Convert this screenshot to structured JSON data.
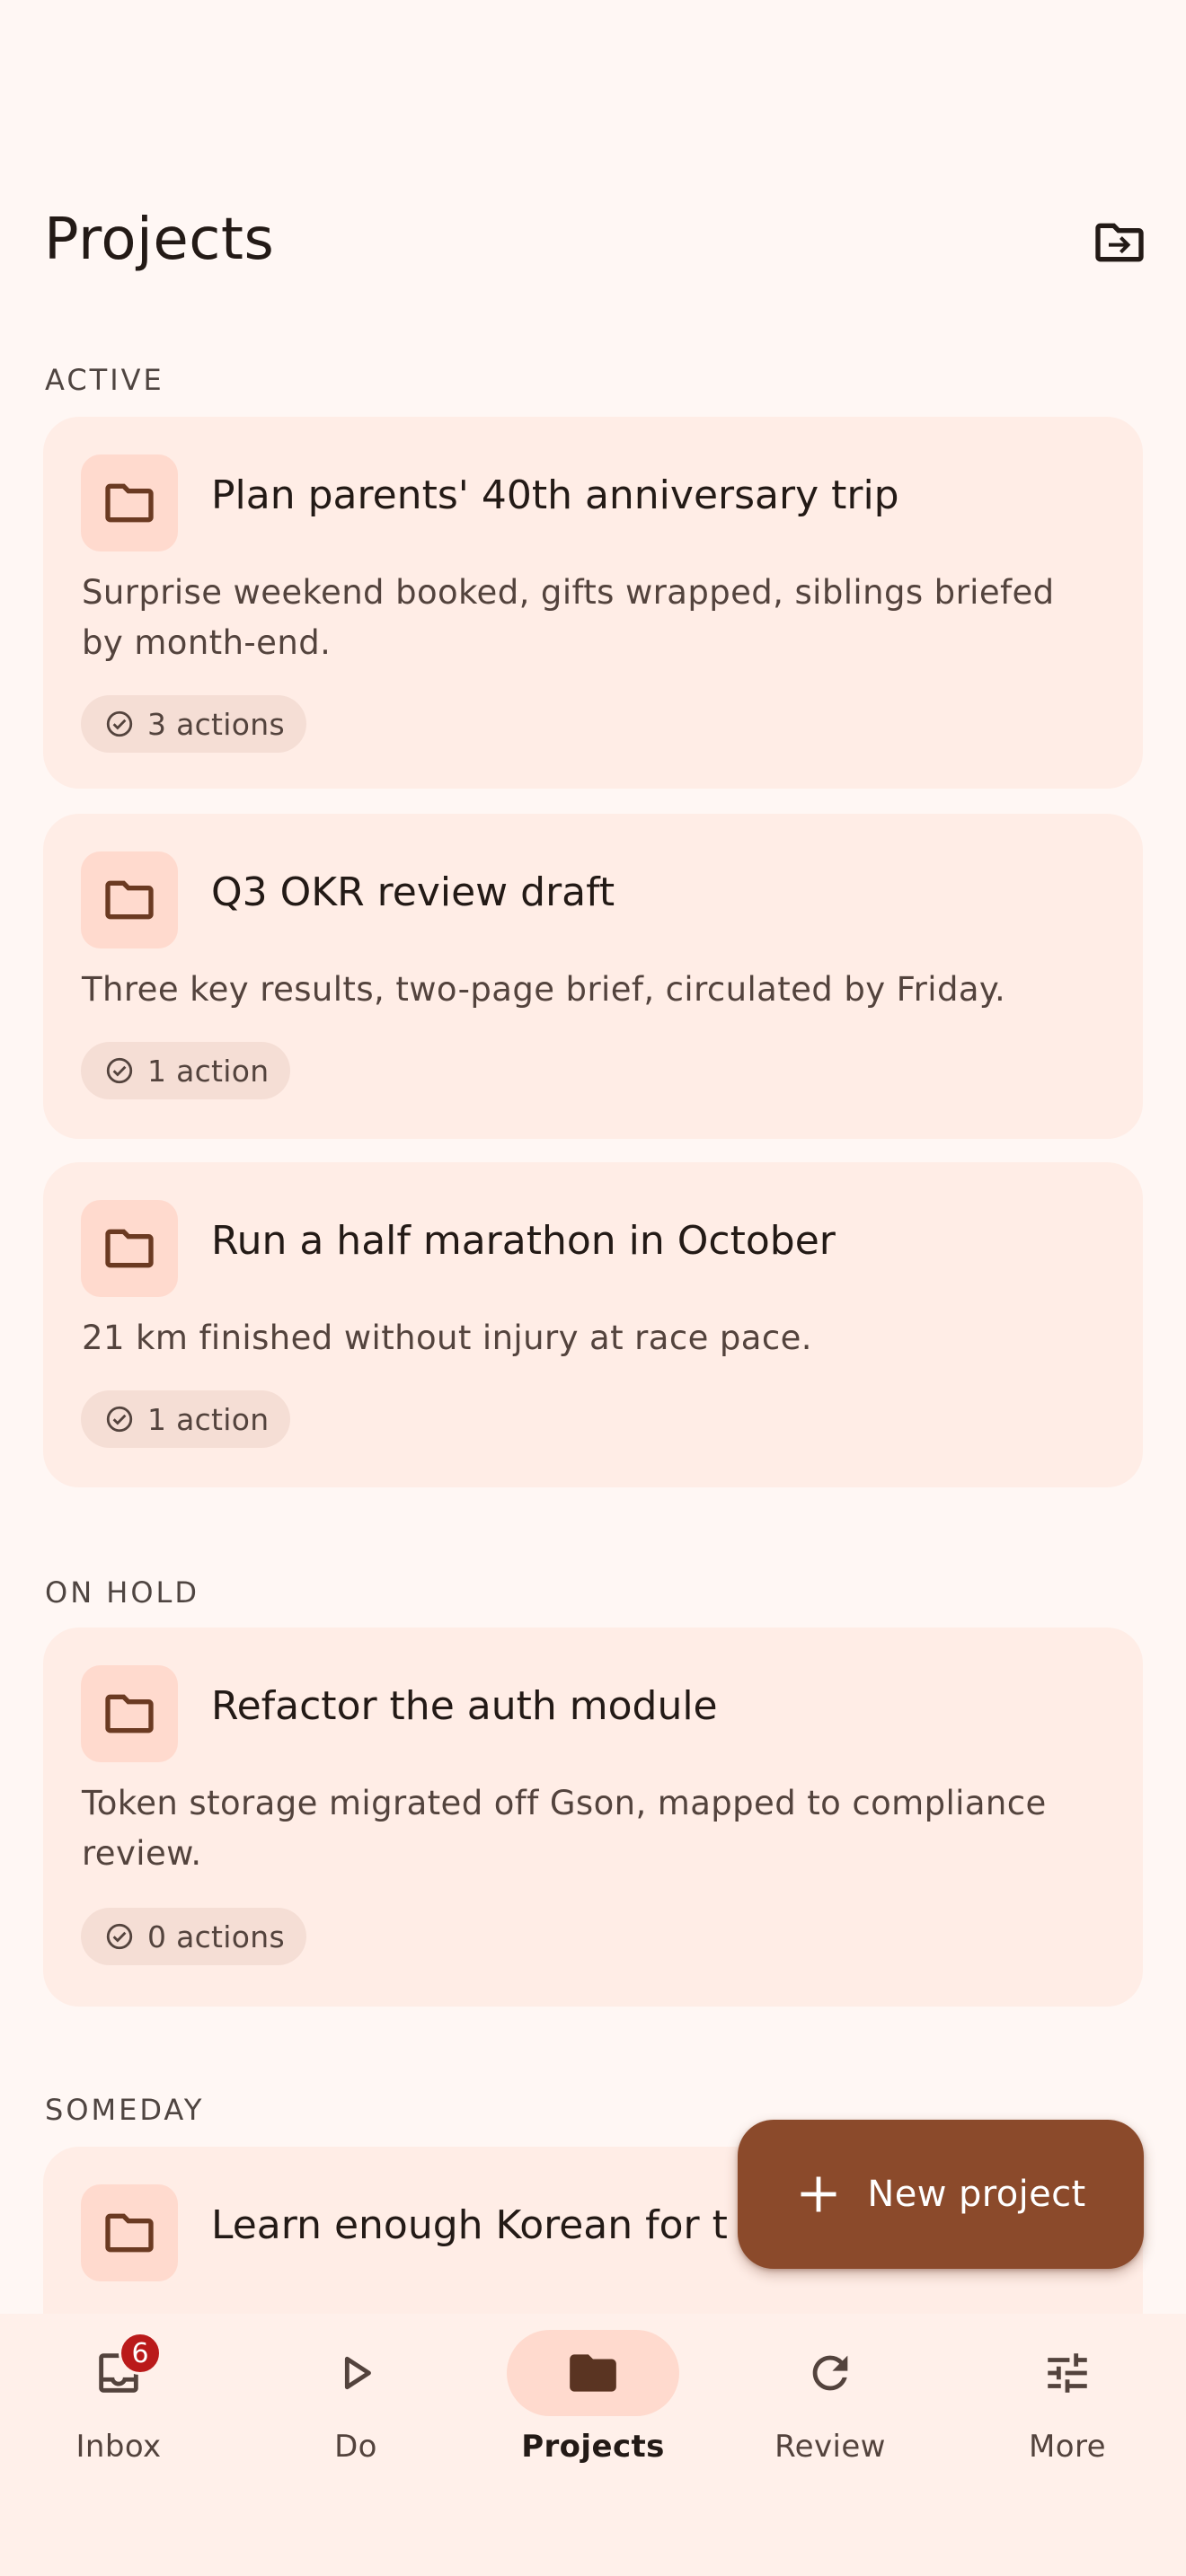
{
  "header": {
    "title": "Projects",
    "action_icon": "folder-move-icon"
  },
  "sections": [
    {
      "label": "ACTIVE"
    },
    {
      "label": "ON HOLD"
    },
    {
      "label": "SOMEDAY"
    }
  ],
  "projects": [
    {
      "section": "ACTIVE",
      "title": "Plan parents' 40th anniversary trip",
      "description": "Surprise weekend booked, gifts wrapped, siblings briefed by month-end.",
      "actions": "3 actions"
    },
    {
      "section": "ACTIVE",
      "title": "Q3 OKR review draft",
      "description": "Three key results, two-page brief, circulated by Friday.",
      "actions": "1 action"
    },
    {
      "section": "ACTIVE",
      "title": "Run a half marathon in October",
      "description": "21 km finished without injury at race pace.",
      "actions": "1 action"
    },
    {
      "section": "ON HOLD",
      "title": "Refactor the auth module",
      "description": "Token storage migrated off Gson, mapped to compliance review.",
      "actions": "0 actions"
    },
    {
      "section": "SOMEDAY",
      "title": "Learn enough Korean for t",
      "description": ""
    }
  ],
  "fab": {
    "label": "New project",
    "icon": "plus-icon"
  },
  "nav": {
    "items": [
      {
        "label": "Inbox",
        "icon": "inbox-icon",
        "badge": "6"
      },
      {
        "label": "Do",
        "icon": "play-icon"
      },
      {
        "label": "Projects",
        "icon": "folder-icon",
        "active": true
      },
      {
        "label": "Review",
        "icon": "refresh-icon"
      },
      {
        "label": "More",
        "icon": "tune-icon"
      }
    ]
  },
  "colors": {
    "background": "#FFF7F4",
    "card": "#FFEDE6",
    "folder_tile": "#FFDACE",
    "accent": "#8B4A2B",
    "badge": "#BA1A1A",
    "text_primary": "#231A16",
    "text_secondary": "#53433D"
  }
}
